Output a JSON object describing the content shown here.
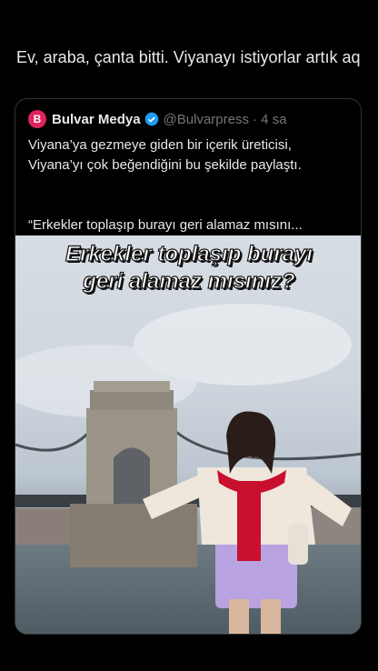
{
  "tweet": {
    "text": "Ev, araba, çanta bitti. Viyanayı istiyorlar artık aq"
  },
  "quote": {
    "logo_letter": "B",
    "author": "Bulvar Medya",
    "handle": "@Bulvarpress",
    "time": "· 4 sa",
    "text": "Viyana’ya gezmeye giden bir içerik üreticisi, Viyana’yı çok beğendiğini bu şekilde paylaştı.",
    "quote_text": "“Erkekler toplaşıp burayı geri alamaz mısını...",
    "video_overlay_line1": "Erkekler toplaşıp burayı",
    "video_overlay_line2": "geri alamaz mısınız?"
  },
  "colors": {
    "background": "#000000",
    "text": "#e7e9ea",
    "muted": "#71767b",
    "verified": "#1d9bf0",
    "logo": "#e0245e",
    "scarf": "#c8102e",
    "skirt": "#b9a2e0"
  }
}
